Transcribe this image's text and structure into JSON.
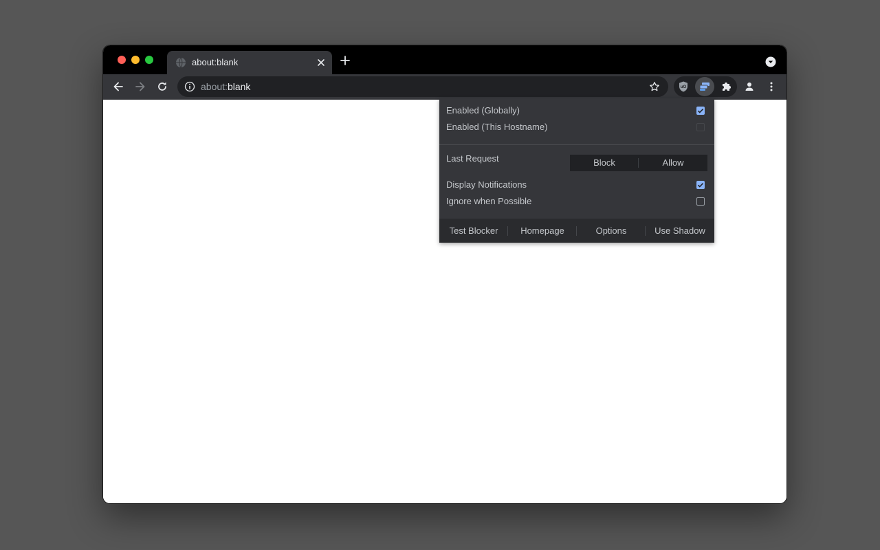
{
  "browser": {
    "tab": {
      "title": "about:blank"
    },
    "omnibox": {
      "scheme": "about:",
      "host": "blank"
    }
  },
  "icons": {
    "back": "arrow-left-icon",
    "forward": "arrow-right-icon",
    "reload": "reload-icon",
    "info": "info-icon",
    "bookmark": "star-icon",
    "extension_ublock": "ublock-shield-icon",
    "extension_active": "popup-blocker-icon",
    "extensions": "puzzle-icon",
    "profile": "person-icon",
    "menu": "kebab-menu-icon",
    "tab_search": "chevron-down-circle-icon"
  },
  "popup": {
    "enabled_globally": {
      "label": "Enabled (Globally)",
      "checked": true
    },
    "enabled_hostname": {
      "label": "Enabled (This Hostname)",
      "checked": false
    },
    "last_request": {
      "label": "Last Request",
      "block_label": "Block",
      "allow_label": "Allow"
    },
    "display_notifications": {
      "label": "Display Notifications",
      "checked": true
    },
    "ignore_when_possible": {
      "label": "Ignore when Possible",
      "checked": false
    },
    "footer": {
      "test_blocker": "Test Blocker",
      "homepage": "Homepage",
      "options": "Options",
      "use_shadow": "Use Shadow"
    }
  },
  "colors": {
    "desktop": "#565656",
    "tabstrip": "#000000",
    "toolbar": "#35363a",
    "checkbox_accent": "#8ab4f8"
  }
}
